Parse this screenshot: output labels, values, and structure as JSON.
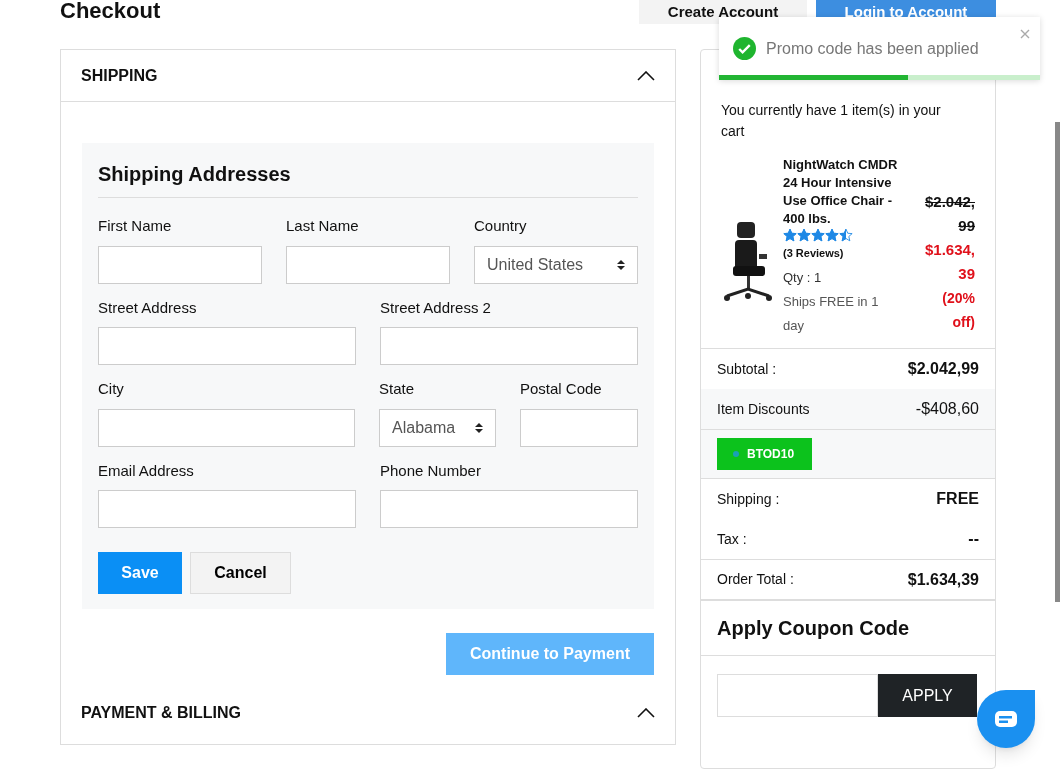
{
  "page_title": "Checkout",
  "header_buttons": [
    {
      "label": "Create Account",
      "kind": "secondary"
    },
    {
      "label": "Login to Account",
      "kind": "primary"
    }
  ],
  "shipping": {
    "title": "SHIPPING",
    "expanded": true,
    "form": {
      "title": "Shipping Addresses",
      "rows": [
        [
          {
            "label": "First Name",
            "kind": "input"
          },
          {
            "label": "Last Name",
            "kind": "input"
          },
          {
            "label": "Country",
            "kind": "select",
            "value": "United States"
          }
        ],
        [
          {
            "label": "Street Address",
            "kind": "input"
          },
          {
            "label": "Street Address 2",
            "kind": "input"
          }
        ],
        [
          {
            "label": "City",
            "kind": "input"
          },
          {
            "label": "State",
            "kind": "select",
            "value": "Alabama"
          },
          {
            "label": "Postal Code",
            "kind": "input"
          }
        ],
        [
          {
            "label": "Email Address",
            "kind": "input"
          },
          {
            "label": "Phone Number",
            "kind": "input"
          }
        ]
      ],
      "buttons": [
        {
          "label": "Save",
          "kind": "primary"
        },
        {
          "label": "Cancel",
          "kind": "secondary"
        }
      ]
    },
    "continue_button": {
      "label": "Continue to Payment",
      "disabled": true
    }
  },
  "payment": {
    "title": "PAYMENT & BILLING",
    "expanded": true
  },
  "cart": {
    "intro": "You currently have 1 item(s) in your cart",
    "item": {
      "name": "NightWatch CMDR 24 Hour Intensive Use Office Chair - 400 lbs.",
      "stars": 4.5,
      "reviews": "(3 Reviews)",
      "qty": "Qty : 1",
      "shipping_note": "Ships FREE in 1 day",
      "old_price": "$2.042,99",
      "price": "$1.634,39",
      "discount": "(20% off)"
    },
    "totals": [
      {
        "label": "Subtotal :",
        "value": "$2.042,99",
        "kind": "bold"
      },
      {
        "label": "Item Discounts",
        "value": "-$408,60",
        "kind": "discount"
      },
      {
        "label": "BTOD10",
        "kind": "coupon"
      },
      {
        "label": "Shipping :",
        "value": "FREE",
        "kind": "bold"
      },
      {
        "label": "Tax :",
        "value": "--",
        "kind": "bold"
      },
      {
        "label": "Order Total :",
        "value": "$1.634,39",
        "kind": "bold"
      }
    ],
    "coupon": {
      "title": "Apply Coupon Code",
      "button": "APPLY"
    }
  },
  "toast": {
    "message": "Promo code has been applied",
    "level": 0.59
  }
}
